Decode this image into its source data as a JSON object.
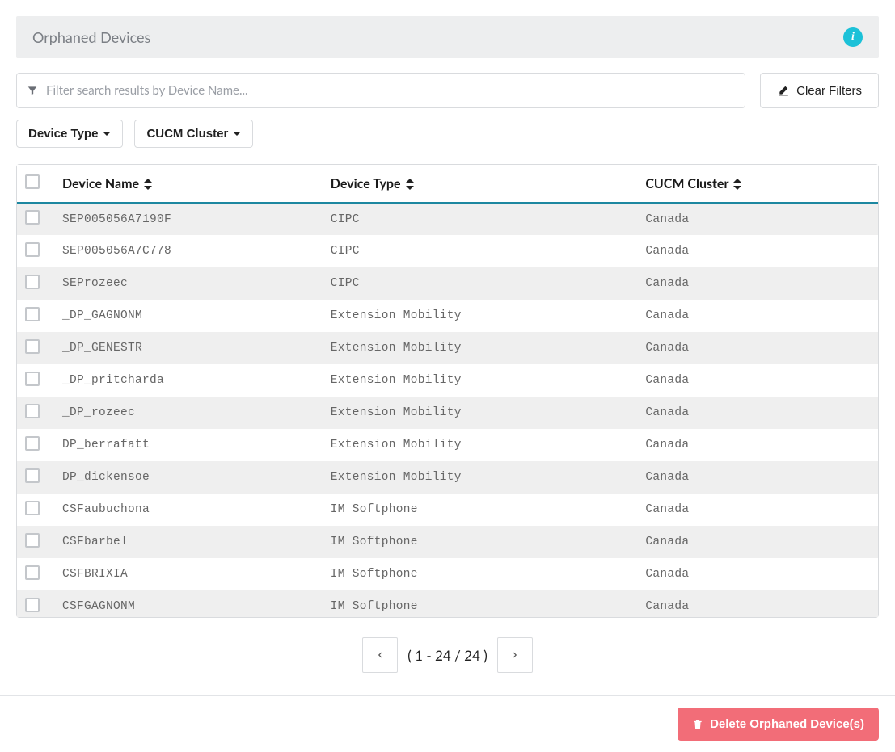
{
  "header": {
    "title": "Orphaned Devices"
  },
  "search": {
    "placeholder": "Filter search results by Device Name..."
  },
  "buttons": {
    "clear_filters": "Clear Filters",
    "device_type": "Device Type",
    "cucm_cluster": "CUCM Cluster",
    "delete": "Delete Orphaned Device(s)"
  },
  "columns": {
    "device_name": "Device Name",
    "device_type": "Device Type",
    "cucm_cluster": "CUCM Cluster"
  },
  "rows": [
    {
      "name": "SEP005056A7190F",
      "type": "CIPC",
      "cluster": "Canada"
    },
    {
      "name": "SEP005056A7C778",
      "type": "CIPC",
      "cluster": "Canada"
    },
    {
      "name": "SEProzeec",
      "type": "CIPC",
      "cluster": "Canada"
    },
    {
      "name": "_DP_GAGNONM",
      "type": "Extension Mobility",
      "cluster": "Canada"
    },
    {
      "name": "_DP_GENESTR",
      "type": "Extension Mobility",
      "cluster": "Canada"
    },
    {
      "name": "_DP_pritcharda",
      "type": "Extension Mobility",
      "cluster": "Canada"
    },
    {
      "name": "_DP_rozeec",
      "type": "Extension Mobility",
      "cluster": "Canada"
    },
    {
      "name": "DP_berrafatt",
      "type": "Extension Mobility",
      "cluster": "Canada"
    },
    {
      "name": "DP_dickensoe",
      "type": "Extension Mobility",
      "cluster": "Canada"
    },
    {
      "name": "CSFaubuchona",
      "type": "IM Softphone",
      "cluster": "Canada"
    },
    {
      "name": "CSFbarbel",
      "type": "IM Softphone",
      "cluster": "Canada"
    },
    {
      "name": "CSFBRIXIA",
      "type": "IM Softphone",
      "cluster": "Canada"
    },
    {
      "name": "CSFGAGNONM",
      "type": "IM Softphone",
      "cluster": "Canada"
    }
  ],
  "pagination": {
    "label": "( 1 - 24 / 24 )"
  }
}
